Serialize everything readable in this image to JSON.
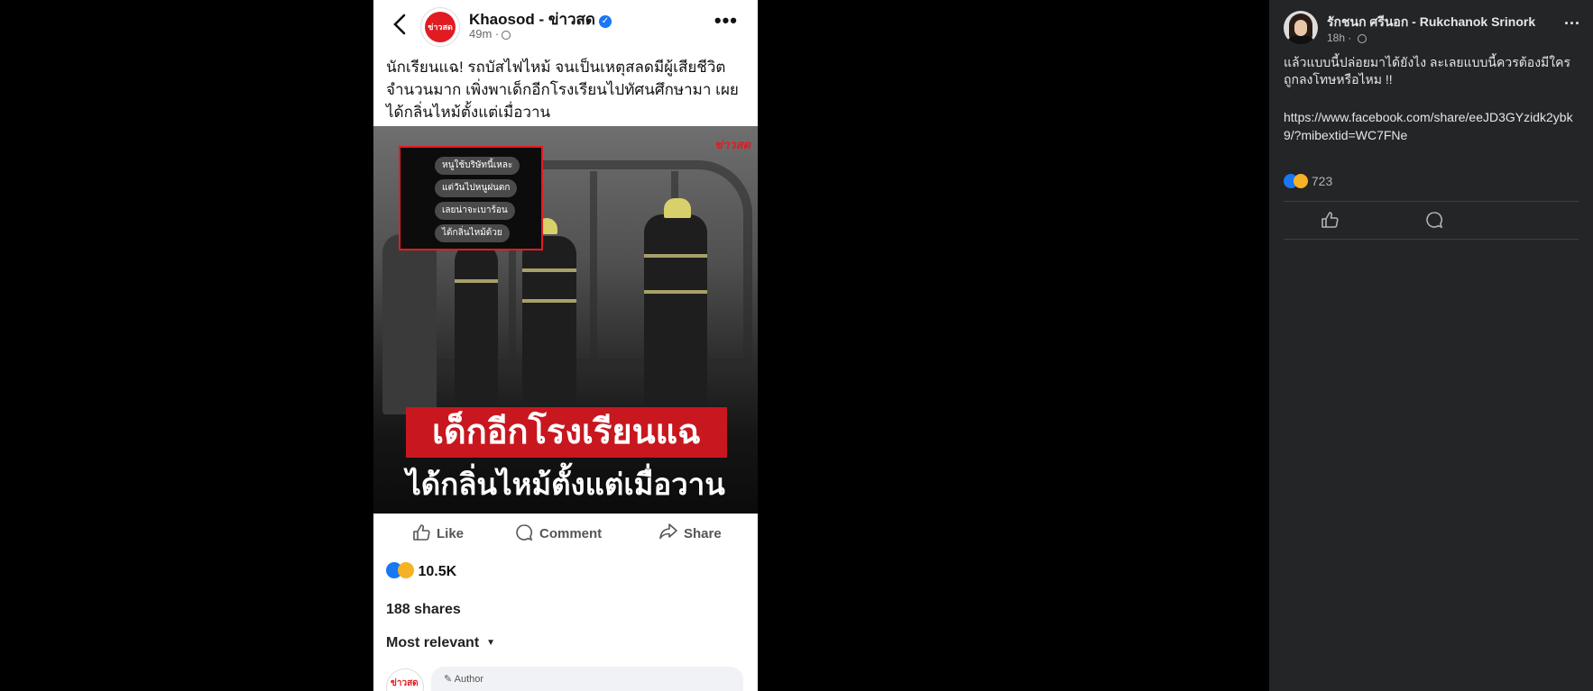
{
  "phone_post": {
    "page_name": "Khaosod - ข่าวสด",
    "logo_text": "ข่าวสด",
    "time": "49m ·",
    "text": "นักเรียนแฉ! รถบัสไฟไหม้ จนเป็นเหตุสลดมีผู้เสียชีวิตจำนวนมาก เพิ่งพาเด็กอีกโรงเรียนไปทัศนศึกษามา เผยได้กลิ่นไหม้ตั้งแต่เมื่อวาน",
    "image": {
      "watermark": "ข่าวสด",
      "chat_lines": [
        "หนูใช้บริษัทนี้เหละ",
        "แต่วันไปหนูฝนตก",
        "เลยน่าจะเบาร้อน",
        "ได้กลิ่นไหม้ด้วย"
      ],
      "headline_red": "เด็กอีกโรงเรียนแฉ",
      "headline_white": "ได้กลิ่นไหม้ตั้งแต่เมื่อวาน"
    },
    "actions": {
      "like": "Like",
      "comment": "Comment",
      "share": "Share"
    },
    "reaction_count": "10.5K",
    "shares": "188 shares",
    "sort_label": "Most relevant",
    "comment_preview": {
      "avatar_text": "ข่าวสด",
      "author_label": "Author"
    }
  },
  "side_post": {
    "author": "รักชนก ศรีนอก - Rukchanok Srinork",
    "time": "18h ·",
    "text": "แล้วแบบนี้ปล่อยมาได้ยังไง ละเลยแบบนี้ควรต้องมีใครถูกลงโทษหรือไหม !!",
    "link": "https://www.facebook.com/share/eeJD3GYzidk2ybk9/?mibextid=WC7FNe",
    "reaction_count": "723"
  },
  "colors": {
    "page_bg": "#000000",
    "side_bg": "#242526",
    "accent_red": "#c8171f",
    "fb_blue": "#1877f2"
  }
}
